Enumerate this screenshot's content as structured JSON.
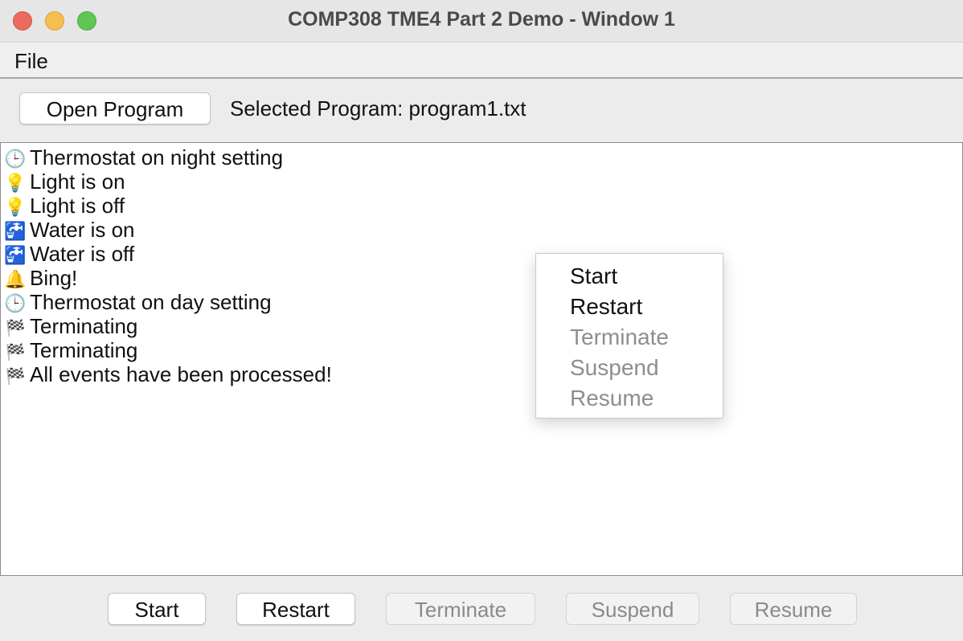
{
  "window": {
    "title": "COMP308 TME4 Part 2 Demo - Window 1"
  },
  "menu": {
    "file_label": "File"
  },
  "toolbar": {
    "open_button_label": "Open Program",
    "selected_program_text": "Selected Program: program1.txt"
  },
  "log": [
    {
      "icon": "clock-icon",
      "glyph": "🕒",
      "text": "Thermostat on night setting"
    },
    {
      "icon": "light-bulb-icon",
      "glyph": "💡",
      "text": "Light is on"
    },
    {
      "icon": "light-bulb-icon",
      "glyph": "💡",
      "text": "Light is off"
    },
    {
      "icon": "water-tap-icon",
      "glyph": "🚰",
      "text": "Water is on"
    },
    {
      "icon": "water-tap-icon",
      "glyph": "🚰",
      "text": "Water is off"
    },
    {
      "icon": "bell-icon",
      "glyph": "🔔",
      "text": "Bing!"
    },
    {
      "icon": "clock-icon",
      "glyph": "🕒",
      "text": "Thermostat on day setting"
    },
    {
      "icon": "checkered-flag-icon",
      "glyph": "🏁",
      "text": "Terminating"
    },
    {
      "icon": "checkered-flag-icon",
      "glyph": "🏁",
      "text": "Terminating"
    },
    {
      "icon": "checkered-flag-icon",
      "glyph": "🏁",
      "text": "All events have been processed!"
    }
  ],
  "context_menu": {
    "items": [
      {
        "label": "Start",
        "enabled": true
      },
      {
        "label": "Restart",
        "enabled": true
      },
      {
        "label": "Terminate",
        "enabled": false
      },
      {
        "label": "Suspend",
        "enabled": false
      },
      {
        "label": "Resume",
        "enabled": false
      }
    ]
  },
  "bottom_buttons": [
    {
      "label": "Start",
      "enabled": true
    },
    {
      "label": "Restart",
      "enabled": true
    },
    {
      "label": "Terminate",
      "enabled": false
    },
    {
      "label": "Suspend",
      "enabled": false
    },
    {
      "label": "Resume",
      "enabled": false
    }
  ],
  "colors": {
    "close": "#ed6a5e",
    "minimize": "#f5bf4f",
    "maximize": "#61c554",
    "disabled_text": "#8a8a8a"
  }
}
